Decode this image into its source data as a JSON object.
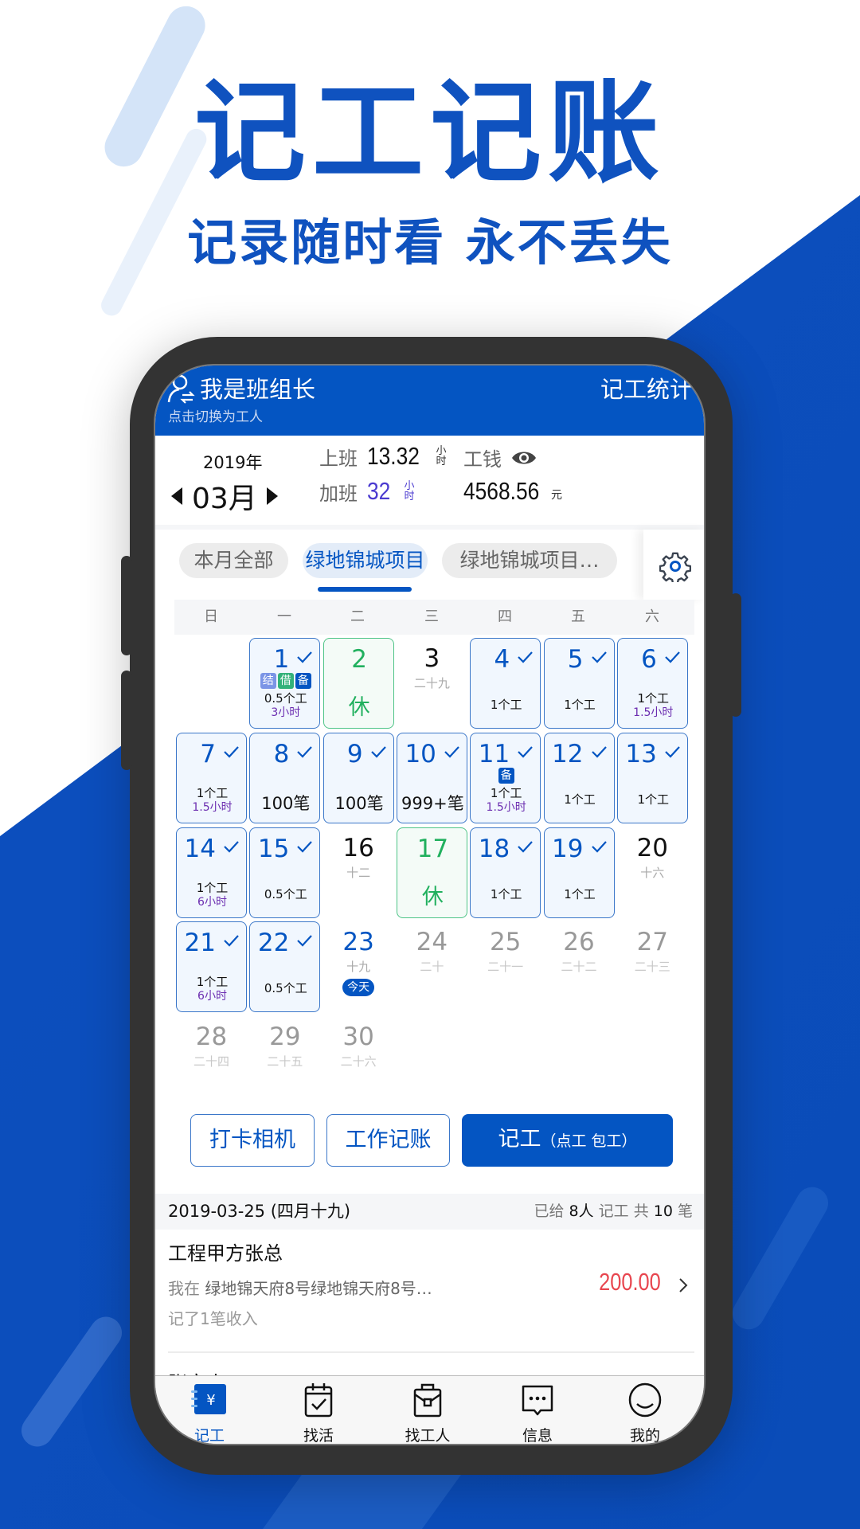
{
  "promo": {
    "title": "记工记账",
    "subtitle": "记录随时看 永不丢失"
  },
  "colors": {
    "brand_blue": "#0455c2",
    "rest_green": "#21b05e",
    "overtime_purple": "#6b2db0",
    "amount_red": "#e8464f"
  },
  "header": {
    "role_icon": "user-switch-icon",
    "role": "我是班组长",
    "switch_hint": "点击切换为工人",
    "stats_link": "记工统计"
  },
  "summary": {
    "year": "2019年",
    "month": "03月",
    "work_label": "上班",
    "work_value": "13.32",
    "work_unit": [
      "小",
      "时"
    ],
    "overtime_label": "加班",
    "overtime_value": "32",
    "overtime_unit": [
      "小",
      "时"
    ],
    "wage_label": "工钱",
    "wage_value": "4568.56",
    "wage_unit": "元"
  },
  "project_tabs": [
    {
      "label": "本月全部",
      "active": false
    },
    {
      "label": "绿地锦城项目",
      "active": true
    },
    {
      "label": "绿地锦城项目…",
      "active": false
    }
  ],
  "weekdays": [
    "日",
    "一",
    "二",
    "三",
    "四",
    "五",
    "六"
  ],
  "calendar": [
    {
      "day": "1",
      "type": "work",
      "checked": true,
      "tags": [
        {
          "t": "结",
          "c": "#7b95e6"
        },
        {
          "t": "借",
          "c": "#33b27a"
        },
        {
          "t": "备",
          "c": "#0455c2"
        }
      ],
      "line1": "0.5个工",
      "line2": "3小时"
    },
    {
      "day": "2",
      "type": "rest",
      "rest": "休"
    },
    {
      "day": "3",
      "type": "plain",
      "lunar": "二十九"
    },
    {
      "day": "4",
      "type": "work",
      "checked": true,
      "line1": "1个工"
    },
    {
      "day": "5",
      "type": "work",
      "checked": true,
      "line1": "1个工"
    },
    {
      "day": "6",
      "type": "work",
      "checked": true,
      "line1": "1个工",
      "line2": "1.5小时"
    },
    {
      "day": "7",
      "type": "work",
      "checked": true,
      "line1": "1个工",
      "line2": "1.5小时"
    },
    {
      "day": "8",
      "type": "work",
      "checked": true,
      "big": "100笔"
    },
    {
      "day": "9",
      "type": "work",
      "checked": true,
      "big": "100笔"
    },
    {
      "day": "10",
      "type": "work",
      "checked": true,
      "big": "999+笔"
    },
    {
      "day": "11",
      "type": "work",
      "checked": true,
      "tags": [
        {
          "t": "备",
          "c": "#0455c2"
        }
      ],
      "line1": "1个工",
      "line2": "1.5小时"
    },
    {
      "day": "12",
      "type": "work",
      "checked": true,
      "line1": "1个工"
    },
    {
      "day": "13",
      "type": "work",
      "checked": true,
      "line1": "1个工"
    },
    {
      "day": "14",
      "type": "work",
      "checked": true,
      "line1": "1个工",
      "line2": "6小时"
    },
    {
      "day": "15",
      "type": "work",
      "checked": true,
      "line1": "0.5个工"
    },
    {
      "day": "16",
      "type": "plain",
      "lunar": "十二"
    },
    {
      "day": "17",
      "type": "rest",
      "rest": "休"
    },
    {
      "day": "18",
      "type": "work",
      "checked": true,
      "line1": "1个工"
    },
    {
      "day": "19",
      "type": "work",
      "checked": true,
      "line1": "1个工"
    },
    {
      "day": "20",
      "type": "plain",
      "lunar": "十六"
    },
    {
      "day": "21",
      "type": "work",
      "checked": true,
      "line1": "1个工",
      "line2": "6小时"
    },
    {
      "day": "22",
      "type": "work",
      "checked": true,
      "line1": "0.5个工"
    },
    {
      "day": "23",
      "type": "today",
      "lunar": "十九",
      "badge": "今天"
    },
    {
      "day": "24",
      "type": "future",
      "lunar": "二十"
    },
    {
      "day": "25",
      "type": "future",
      "lunar": "二十一"
    },
    {
      "day": "26",
      "type": "future",
      "lunar": "二十二"
    },
    {
      "day": "27",
      "type": "future",
      "lunar": "二十三"
    },
    {
      "day": "28",
      "type": "future",
      "lunar": "二十四"
    },
    {
      "day": "29",
      "type": "future",
      "lunar": "二十五"
    },
    {
      "day": "30",
      "type": "future",
      "lunar": "二十六"
    }
  ],
  "calendar_first_weekday": 1,
  "actions": {
    "camera": "打卡相机",
    "ledger": "工作记账",
    "record": "记工",
    "record_sub": "（点工 包工）"
  },
  "list": {
    "date": "2019-03-25 (四月十九)",
    "summary_prefix": "已给",
    "summary_people": "8人",
    "summary_mid": "记工  共",
    "summary_count": "10",
    "summary_suffix": "笔",
    "items": [
      {
        "name": "工程甲方张总",
        "desc_prefix": "我在",
        "desc": "绿地锦天府8号绿地锦天府8号…",
        "note": "记了1笔收入",
        "amount": "200.00"
      },
      {
        "name": "张家忠"
      }
    ]
  },
  "tabbar": [
    {
      "label": "记工",
      "icon": "ledger-icon",
      "active": true
    },
    {
      "label": "找活",
      "icon": "calendar-check-icon",
      "active": false
    },
    {
      "label": "找工人",
      "icon": "briefcase-icon",
      "active": false
    },
    {
      "label": "信息",
      "icon": "message-icon",
      "active": false
    },
    {
      "label": "我的",
      "icon": "smile-icon",
      "active": false
    }
  ]
}
